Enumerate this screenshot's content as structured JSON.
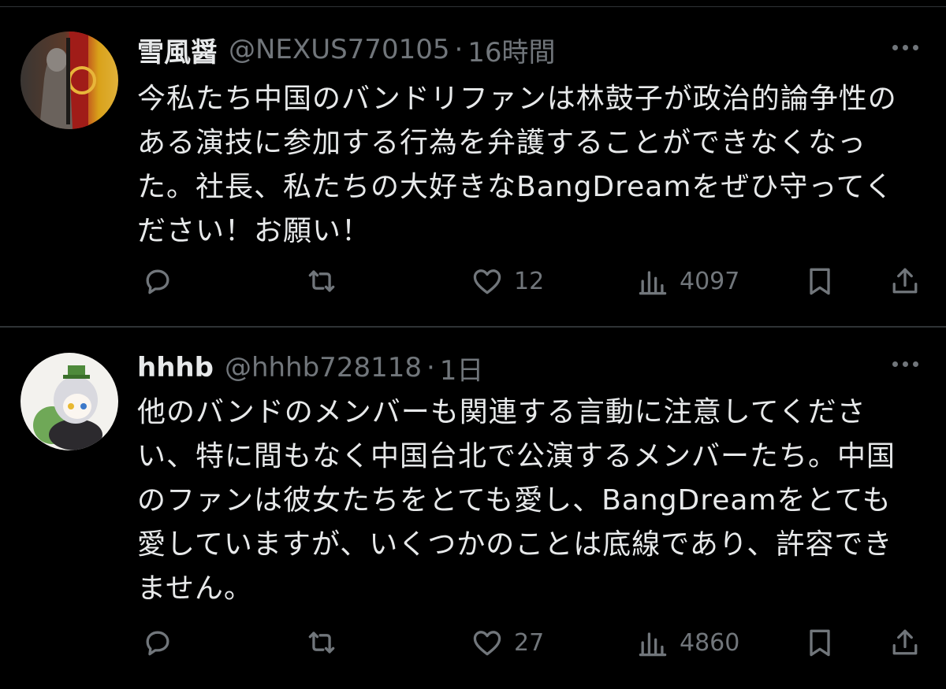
{
  "tweets": [
    {
      "author_name": "雪風醤",
      "handle": "@NEXUS770105",
      "separator": "·",
      "time": "16時間",
      "text": "今私たち中国のバンドリファンは林鼓子が政治的論争性のある演技に参加する行為を弁護することができなくなった。社長、私たちの大好きなBangDreamをぜひ守ってください！お願い！",
      "replies": "",
      "retweets": "",
      "likes": "12",
      "views": "4097"
    },
    {
      "author_name": "hhhb",
      "handle": "@hhhb728118",
      "separator": "·",
      "time": "1日",
      "text": "他のバンドのメンバーも関連する言動に注意してください、特に間もなく中国台北で公演するメンバーたち。中国のファンは彼女たちをとても愛し、BangDreamをとても愛していますが、いくつかのことは底線であり、許容できません。",
      "replies": "",
      "retweets": "",
      "likes": "27",
      "views": "4860"
    }
  ],
  "icons": {
    "reply": "reply-icon",
    "retweet": "retweet-icon",
    "like": "heart-icon",
    "views": "views-icon",
    "bookmark": "bookmark-icon",
    "share": "share-icon",
    "more": "more-icon"
  },
  "colors": {
    "background": "#000000",
    "text": "#e7e9ea",
    "secondary": "#71767b",
    "divider": "#2f3336"
  }
}
